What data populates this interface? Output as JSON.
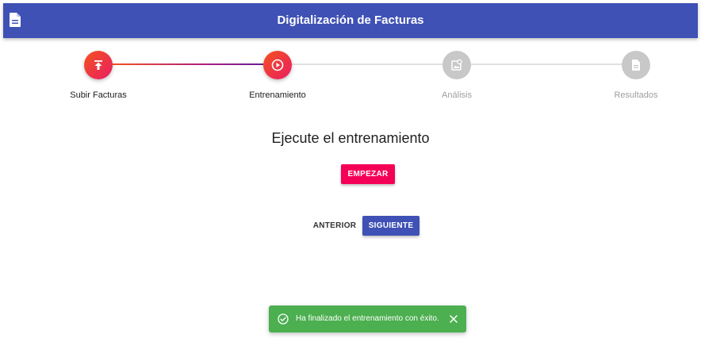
{
  "appbar": {
    "title": "Digitalización de Facturas",
    "icon": "document-icon",
    "color": "#3f51b5"
  },
  "stepper": {
    "steps": [
      {
        "label": "Subir Facturas",
        "icon": "upload-icon",
        "state": "done"
      },
      {
        "label": "Entrenamiento",
        "icon": "play-icon",
        "state": "current"
      },
      {
        "label": "Análisis",
        "icon": "image-analysis-icon",
        "state": "pending"
      },
      {
        "label": "Resultados",
        "icon": "document-icon",
        "state": "pending"
      }
    ]
  },
  "main": {
    "heading": "Ejecute el entrenamiento",
    "start_label": "EMPEZAR",
    "start_color": "#f50057"
  },
  "nav": {
    "prev_label": "ANTERIOR",
    "next_label": "SIGUIENTE"
  },
  "snackbar": {
    "message": "Ha finalizado el entrenamiento con éxito.",
    "icon": "check-circle-icon",
    "color": "#4caf50"
  }
}
